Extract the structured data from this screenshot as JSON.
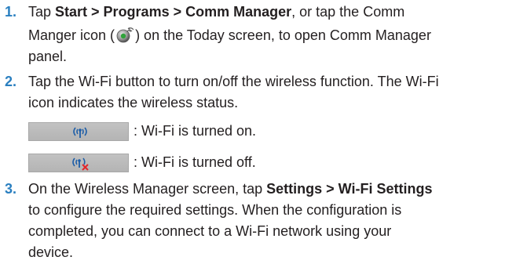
{
  "steps": [
    {
      "number": "1.",
      "line1_pre": "Tap ",
      "line1_bold": "Start > Programs > Comm Manager",
      "line1_post": ", or tap the Comm",
      "line2_pre": "Manger icon (",
      "line2_post": ") on the Today screen, to open Comm Manager",
      "line3": "panel."
    },
    {
      "number": "2.",
      "line1": "Tap the Wi-Fi button to turn on/off the wireless function. The Wi-Fi",
      "line2": "icon indicates the wireless status."
    },
    {
      "number": "3.",
      "line1_pre": "On the Wireless Manager screen, tap ",
      "line1_bold": "Settings > Wi-Fi Settings",
      "line2": "to configure the required settings. When the configuration is",
      "line3": "completed, you can connect to a Wi-Fi network using your",
      "line4": "device."
    }
  ],
  "status": {
    "on_text": ": Wi-Fi is turned on.",
    "off_text": ": Wi-Fi is turned off."
  },
  "icons": {
    "comm_manager": "comm-manager-icon",
    "wifi_on": "wifi-on-icon",
    "wifi_off": "wifi-off-icon"
  },
  "colors": {
    "step_number": "#2a7fc0",
    "wifi_glyph": "#1f5fa8",
    "off_cross": "#e3262b"
  }
}
